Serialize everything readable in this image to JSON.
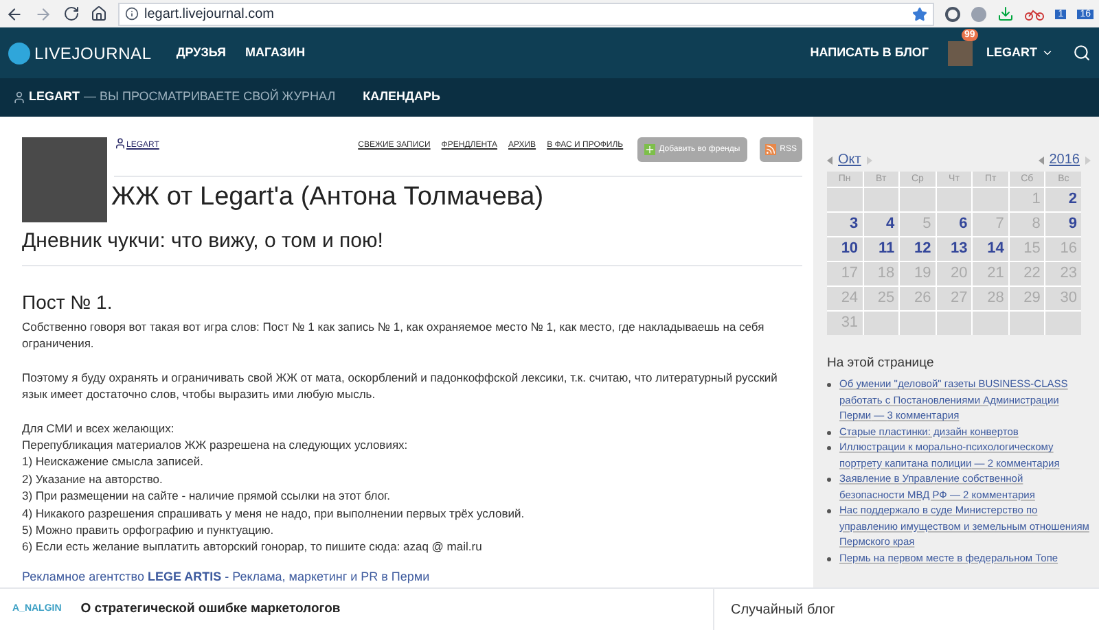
{
  "browser": {
    "url": "legart.livejournal.com",
    "extension_badges": [
      "1",
      "16"
    ]
  },
  "header": {
    "logo": "LIVEJOURNAL",
    "nav": [
      "ДРУЗЬЯ",
      "МАГАЗИН"
    ],
    "write": "НАПИСАТЬ В БЛОГ",
    "notifications": "99",
    "user": "LEGART"
  },
  "subheader": {
    "user": "LEGART",
    "note": "— ВЫ ПРОСМАТРИВАЕТЕ СВОЙ ЖУРНАЛ",
    "links": [
      "КАЛЕНДАРЬ"
    ]
  },
  "journal": {
    "user": "LEGART",
    "links": [
      "СВЕЖИЕ ЗАПИСИ",
      "ФРЕНДЛЕНТА",
      "АРХИВ",
      "В ФАС И ПРОФИЛЬ"
    ],
    "add_friend": "Добавить во френды",
    "rss": "RSS",
    "title": "ЖЖ от Legart'а (Антона Толмачева)",
    "subtitle": "Дневник чукчи: что вижу, о том и пою!"
  },
  "post": {
    "title": "Пост № 1.",
    "paragraphs": [
      [
        "Собственно говоря вот такая вот игра слов: Пост № 1 как запись № 1, как охраняемое место № 1, как место, где накладываешь на себя ограничения."
      ],
      [
        "Поэтому я буду охранять и ограничивать свой ЖЖ от мата, оскорблений и падонкоффской лексики, т.к. считаю, что литературный русский язык имеет достаточно слов, чтобы выразить ими любую мысль."
      ],
      [
        "Для СМИ и всех желающих:",
        "Перепубликация материалов ЖЖ разрешена на следующих условиях:",
        "1) Неискажение смысла записей.",
        "2) Указание на авторство.",
        "3) При размещении на сайте - наличие прямой ссылки на этот блог.",
        "4) Никакого разрешения спрашивать у меня не надо, при выполнении первых трёх условий.",
        "5) Можно править орфографию и пунктуацию.",
        "6) Если есть желание выплатить авторский гонорар, то пишите сюда: azaq @ mail.ru"
      ]
    ],
    "ad_link": "Рекламное агентство **LEGE ARTIS** - Реклама, маркетинг и PR в Перми"
  },
  "calendar": {
    "month": "Окт",
    "year": "2016",
    "weekdays": [
      "Пн",
      "Вт",
      "Ср",
      "Чт",
      "Пт",
      "Сб",
      "Вс"
    ],
    "weeks": [
      [
        {
          "kind": "blank"
        },
        {
          "kind": "blank"
        },
        {
          "kind": "blank"
        },
        {
          "kind": "blank"
        },
        {
          "kind": "blank"
        },
        {
          "kind": "day",
          "day": "1",
          "linked": false
        },
        {
          "kind": "day",
          "day": "2",
          "linked": true
        }
      ],
      [
        {
          "kind": "day",
          "day": "3",
          "linked": true
        },
        {
          "kind": "day",
          "day": "4",
          "linked": true
        },
        {
          "kind": "day",
          "day": "5",
          "linked": false
        },
        {
          "kind": "day",
          "day": "6",
          "linked": true
        },
        {
          "kind": "day",
          "day": "7",
          "linked": false
        },
        {
          "kind": "day",
          "day": "8",
          "linked": false
        },
        {
          "kind": "day",
          "day": "9",
          "linked": true
        }
      ],
      [
        {
          "kind": "day",
          "day": "10",
          "linked": true
        },
        {
          "kind": "day",
          "day": "11",
          "linked": true
        },
        {
          "kind": "day",
          "day": "12",
          "linked": true
        },
        {
          "kind": "day",
          "day": "13",
          "linked": true
        },
        {
          "kind": "day",
          "day": "14",
          "linked": true
        },
        {
          "kind": "day",
          "day": "15",
          "linked": false
        },
        {
          "kind": "day",
          "day": "16",
          "linked": false
        }
      ],
      [
        {
          "kind": "day",
          "day": "17",
          "linked": false
        },
        {
          "kind": "day",
          "day": "18",
          "linked": false
        },
        {
          "kind": "day",
          "day": "19",
          "linked": false
        },
        {
          "kind": "day",
          "day": "20",
          "linked": false
        },
        {
          "kind": "day",
          "day": "21",
          "linked": false
        },
        {
          "kind": "day",
          "day": "22",
          "linked": false
        },
        {
          "kind": "day",
          "day": "23",
          "linked": false
        }
      ],
      [
        {
          "kind": "day",
          "day": "24",
          "linked": false
        },
        {
          "kind": "day",
          "day": "25",
          "linked": false
        },
        {
          "kind": "day",
          "day": "26",
          "linked": false
        },
        {
          "kind": "day",
          "day": "27",
          "linked": false
        },
        {
          "kind": "day",
          "day": "28",
          "linked": false
        },
        {
          "kind": "day",
          "day": "29",
          "linked": false
        },
        {
          "kind": "day",
          "day": "30",
          "linked": false
        }
      ],
      [
        {
          "kind": "day",
          "day": "31",
          "linked": false
        },
        {
          "kind": "blank"
        },
        {
          "kind": "blank"
        },
        {
          "kind": "blank"
        },
        {
          "kind": "blank"
        },
        {
          "kind": "blank"
        },
        {
          "kind": "blank"
        }
      ]
    ]
  },
  "on_this_page": {
    "title": "На этой странице",
    "items": [
      {
        "title": "Об умении \"деловой\" газеты BUSINESS-CLASS работать с Постановлениями Администрации Перми",
        "separator": "—",
        "comments": "3 комментария"
      },
      {
        "title": "Старые пластинки: дизайн конвертов"
      },
      {
        "title": "Иллюстрации к морально-психологическому портрету капитана полиции",
        "separator": "—",
        "comments": "2 комментария"
      },
      {
        "title": "Заявление в Управление собственной безопасности МВД РФ",
        "separator": "—",
        "comments": "2 комментария"
      },
      {
        "title": "Нас поддержало в суде Министерство по управлению имуществом и земельным отношениям Пермского края"
      },
      {
        "title": "Пермь на первом месте в федеральном Топе"
      }
    ]
  },
  "bottom_bar": {
    "author": "A_NALGIN",
    "post": "О стратегической ошибке маркетологов",
    "random": "Случайный блог"
  }
}
